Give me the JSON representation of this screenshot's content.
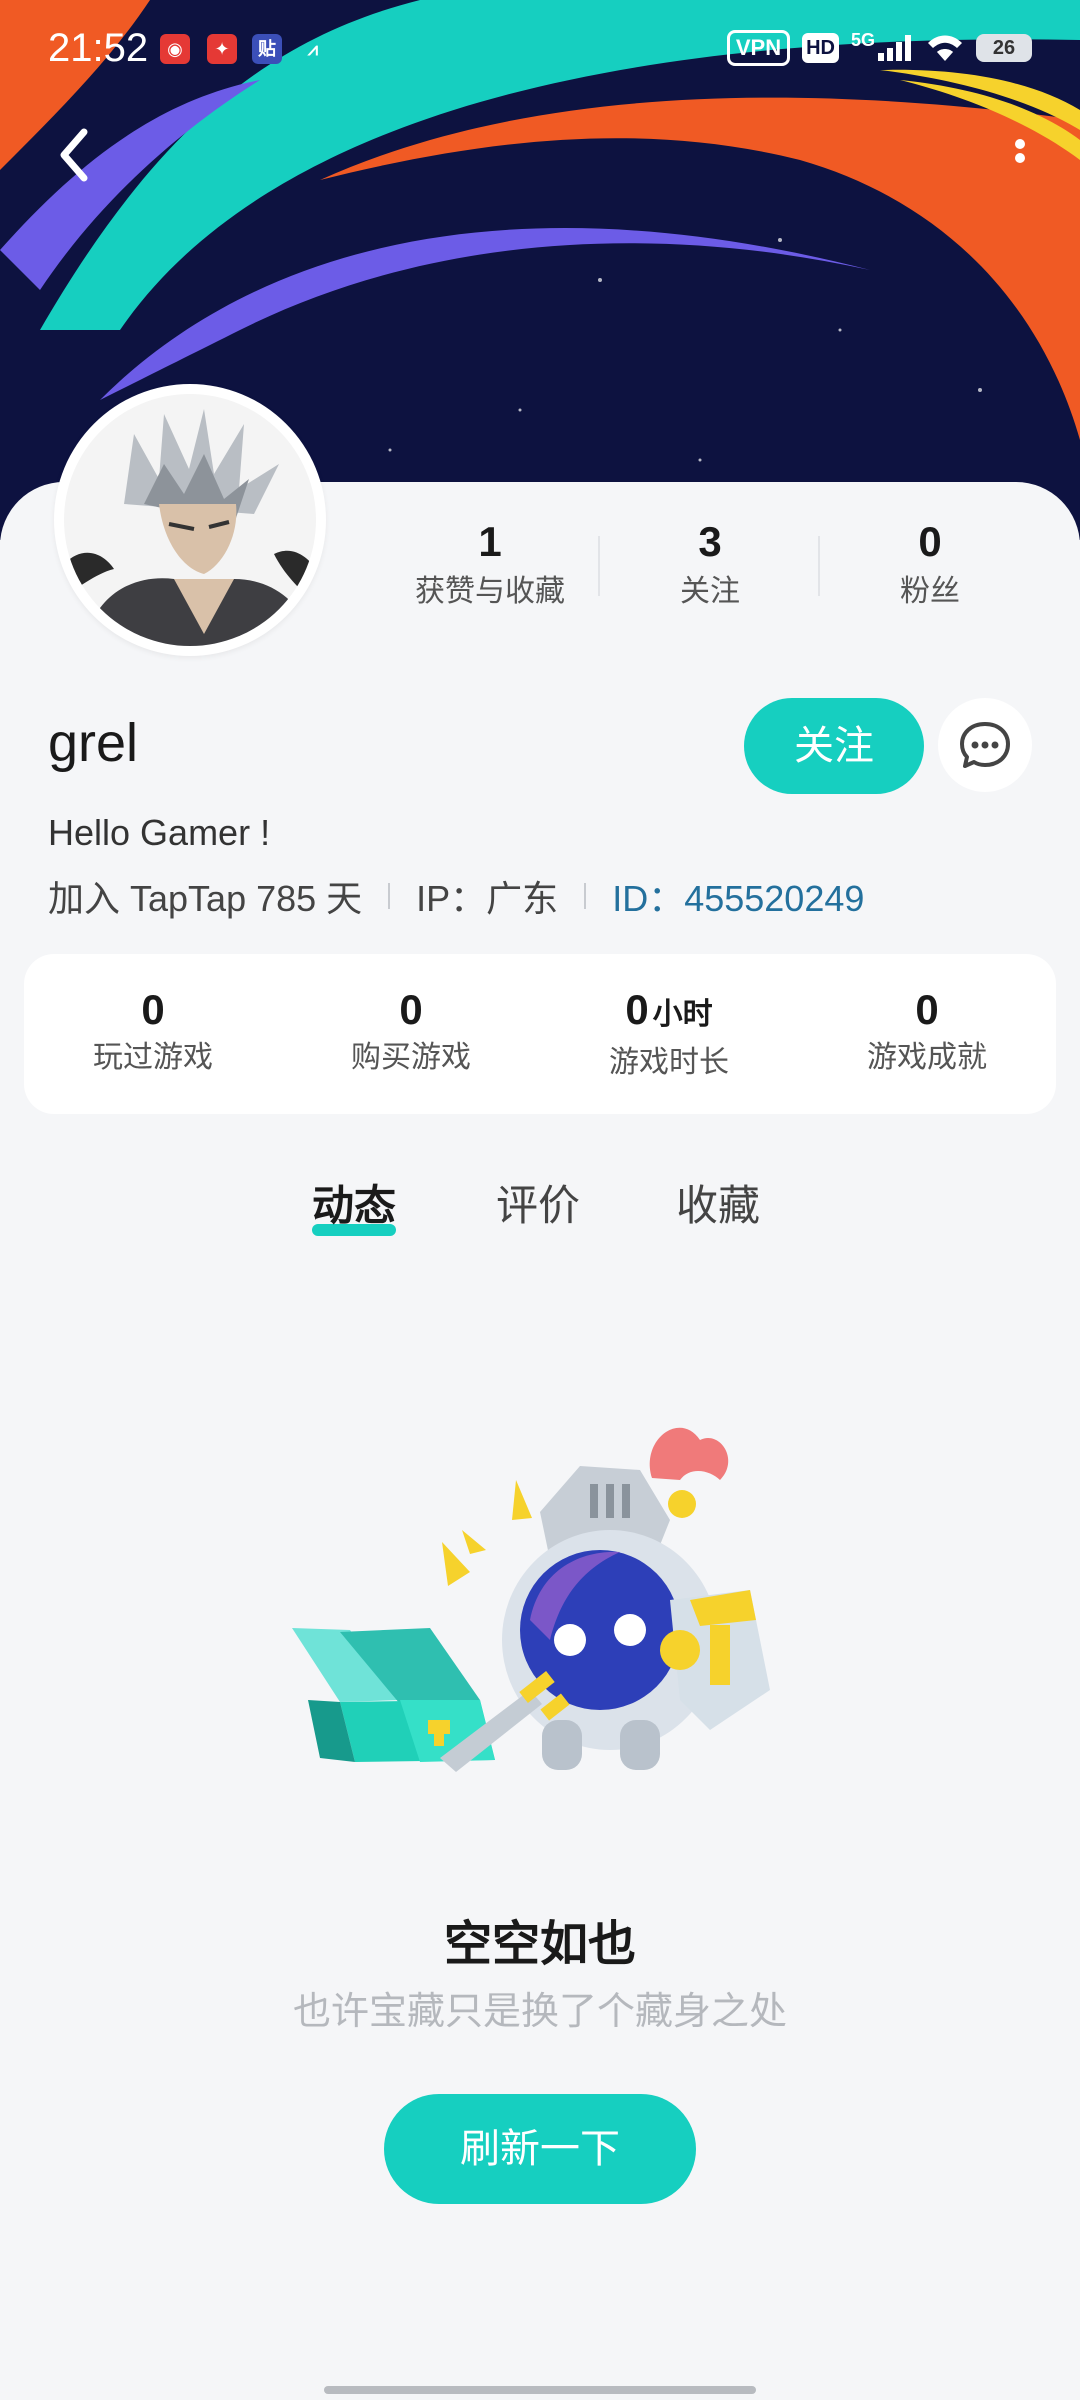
{
  "status_bar": {
    "time": "21:52",
    "vpn": "VPN",
    "hd": "HD",
    "network": "5G",
    "battery": "26"
  },
  "banner": {
    "colors": {
      "bg": "#0d1240",
      "orange": "#f05a24",
      "teal": "#16cfc0",
      "purple": "#6c5ce7",
      "yellow": "#f6d22c"
    }
  },
  "profile": {
    "username": "grel",
    "bio": "Hello Gamer !",
    "joined": "加入 TapTap 785 天",
    "ip": "IP：广东",
    "id": "ID：455520249",
    "follow_label": "关注"
  },
  "social_stats": [
    {
      "num": "1",
      "label": "获赞与收藏"
    },
    {
      "num": "3",
      "label": "关注"
    },
    {
      "num": "0",
      "label": "粉丝"
    }
  ],
  "game_stats": [
    {
      "num": "0",
      "unit": "",
      "label": "玩过游戏"
    },
    {
      "num": "0",
      "unit": "",
      "label": "购买游戏"
    },
    {
      "num": "0",
      "unit": "小时",
      "label": "游戏时长"
    },
    {
      "num": "0",
      "unit": "",
      "label": "游戏成就"
    }
  ],
  "tabs": [
    {
      "label": "动态",
      "active": true
    },
    {
      "label": "评价",
      "active": false
    },
    {
      "label": "收藏",
      "active": false
    }
  ],
  "empty_state": {
    "title": "空空如也",
    "subtitle": "也许宝藏只是换了个藏身之处",
    "button": "刷新一下"
  },
  "accent_color": "#16cfc0"
}
